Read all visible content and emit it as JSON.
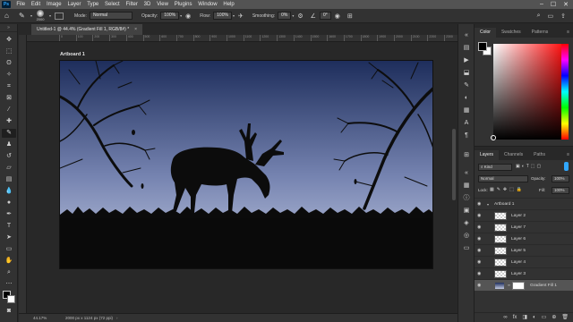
{
  "menubar": {
    "logo": "Ps",
    "items": [
      "File",
      "Edit",
      "Image",
      "Layer",
      "Type",
      "Select",
      "Filter",
      "3D",
      "View",
      "Plugins",
      "Window",
      "Help"
    ]
  },
  "options": {
    "brush_size": "2000",
    "mode_label": "Mode:",
    "mode_value": "Normal",
    "opacity_label": "Opacity:",
    "opacity_value": "100%",
    "flow_label": "Flow:",
    "flow_value": "100%",
    "smoothing_label": "Smoothing:",
    "smoothing_value": "0%",
    "angle_value": "0°"
  },
  "document": {
    "tab_title": "Untitled-1 @ 44.4% (Gradient Fill 1, RGB/8#) *",
    "tab_close": "×",
    "artboard_label": "Artboard 1"
  },
  "ruler_h": [
    "0",
    "100",
    "200",
    "300",
    "400",
    "500",
    "600",
    "700",
    "800",
    "900",
    "1000",
    "1100",
    "1200",
    "1300",
    "1400",
    "1500",
    "1600",
    "1700",
    "1800",
    "1900",
    "2000",
    "2100",
    "2200",
    "2300",
    "2400",
    "2500"
  ],
  "status": {
    "zoom": "44.17%",
    "docinfo": "2000 px x 1124 px (72 ppi)",
    "arrow": "›"
  },
  "color_panel": {
    "tabs": [
      "Color",
      "Swatches",
      "Patterns"
    ],
    "menu": "≡",
    "foreground": "#000000",
    "background": "#ffffff"
  },
  "layers_panel": {
    "tabs": [
      "Layers",
      "Channels",
      "Paths"
    ],
    "menu": "≡",
    "filter_kind": "Kind",
    "blend_mode": "Normal",
    "opacity_label": "Opacity:",
    "opacity_value": "100%",
    "lock_label": "Lock:",
    "fill_label": "Fill:",
    "fill_value": "100%",
    "group": "Artboard 1",
    "layers": [
      {
        "name": "Layer 2"
      },
      {
        "name": "Layer 7"
      },
      {
        "name": "Layer 6"
      },
      {
        "name": "Layer 5"
      },
      {
        "name": "Layer 4"
      },
      {
        "name": "Layer 3"
      },
      {
        "name": "Gradient Fill 1"
      }
    ]
  },
  "colors": {
    "sky_top": "#1e2e5c",
    "sky_bottom": "#b9c3de",
    "accent": "#31a8ff"
  }
}
